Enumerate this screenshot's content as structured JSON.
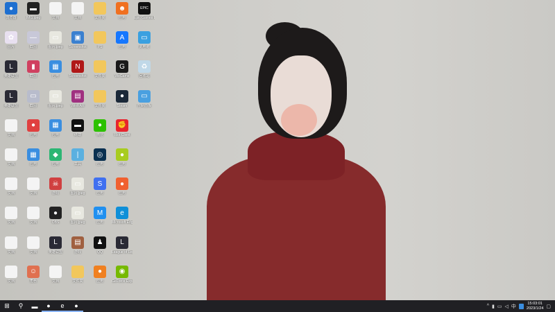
{
  "desktop": {
    "icons": [
      {
        "label": "浏览器",
        "glyph": "●",
        "color": "#1e6fd0"
      },
      {
        "label": "图片",
        "glyph": "✿",
        "color": "#e8e0f0"
      },
      {
        "label": "英雄联盟",
        "glyph": "L",
        "color": "#2a2a35"
      },
      {
        "label": "英雄联盟",
        "glyph": "L",
        "color": "#2a2a35"
      },
      {
        "label": "文档",
        "glyph": "",
        "color": "#f4f4f4"
      },
      {
        "label": "文档",
        "glyph": "",
        "color": "#f4f4f4"
      },
      {
        "label": "文档",
        "glyph": "",
        "color": "#f4f4f4"
      },
      {
        "label": "文档",
        "glyph": "",
        "color": "#f4f4f4"
      },
      {
        "label": "文档",
        "glyph": "",
        "color": "#f4f4f4"
      },
      {
        "label": "文档",
        "glyph": "",
        "color": "#f4f4f4"
      },
      {
        "label": "IMG.jpeg",
        "glyph": "▬",
        "color": "#222"
      },
      {
        "label": "截图",
        "glyph": "—",
        "color": "#c8c8d8"
      },
      {
        "label": "截图",
        "glyph": "▮",
        "color": "#d04060"
      },
      {
        "label": "截图",
        "glyph": "▭",
        "color": "#b8bccc"
      },
      {
        "label": "应用",
        "glyph": "●",
        "color": "#e04040"
      },
      {
        "label": "应用",
        "glyph": "▦",
        "color": "#3a8ee0"
      },
      {
        "label": "文档",
        "glyph": "",
        "color": "#f4f4f4"
      },
      {
        "label": "文档",
        "glyph": "",
        "color": "#f4f4f4"
      },
      {
        "label": "文档",
        "glyph": "",
        "color": "#f4f4f4"
      },
      {
        "label": "角色",
        "glyph": "☺",
        "color": "#e07050"
      },
      {
        "label": "文档",
        "glyph": "",
        "color": "#f4f4f4"
      },
      {
        "label": "图片.jpeg",
        "glyph": "▭",
        "color": "#e8e8e0"
      },
      {
        "label": "应用",
        "glyph": "▦",
        "color": "#3a8ee0"
      },
      {
        "label": "图片.jpeg",
        "glyph": "▭",
        "color": "#e8e8e0"
      },
      {
        "label": "应用",
        "glyph": "▦",
        "color": "#3a8ee0"
      },
      {
        "label": "应用",
        "glyph": "◆",
        "color": "#2bb673"
      },
      {
        "label": "游戏",
        "glyph": "☠",
        "color": "#d04040"
      },
      {
        "label": "OBS",
        "glyph": "●",
        "color": "#222"
      },
      {
        "label": "英雄联盟",
        "glyph": "L",
        "color": "#2a2a35"
      },
      {
        "label": "文档",
        "glyph": "",
        "color": "#f4f4f4"
      },
      {
        "label": "文档",
        "glyph": "",
        "color": "#f4f4f4"
      },
      {
        "label": "Screenshot",
        "glyph": "▣",
        "color": "#3a80d0"
      },
      {
        "label": "Screenshot",
        "glyph": "N",
        "color": "#b01818"
      },
      {
        "label": "WinRAR",
        "glyph": "▤",
        "color": "#a03080"
      },
      {
        "label": "终端",
        "glyph": "▬",
        "color": "#111"
      },
      {
        "label": "工具",
        "glyph": "|",
        "color": "#5ab0e0"
      },
      {
        "label": "图片.jpeg",
        "glyph": "▭",
        "color": "#e8e8e0"
      },
      {
        "label": "图片.jpeg",
        "glyph": "▭",
        "color": "#e8e8e0"
      },
      {
        "label": "游戏",
        "glyph": "▤",
        "color": "#a06040"
      },
      {
        "label": "文件夹",
        "glyph": "",
        "color": "#f2c75c"
      },
      {
        "label": "文件夹",
        "glyph": "",
        "color": "#f2c75c"
      },
      {
        "label": "PS",
        "glyph": "",
        "color": "#f2c75c"
      },
      {
        "label": "文件夹",
        "glyph": "",
        "color": "#f2c75c"
      },
      {
        "label": "文件夹",
        "glyph": "",
        "color": "#f2c75c"
      },
      {
        "label": "微信",
        "glyph": "●",
        "color": "#2dc100"
      },
      {
        "label": "应用",
        "glyph": "◎",
        "color": "#0a3050"
      },
      {
        "label": "应用",
        "glyph": "S",
        "color": "#4070f0"
      },
      {
        "label": "应用",
        "glyph": "M",
        "color": "#2090f0"
      },
      {
        "label": "QQ",
        "glyph": "♟",
        "color": "#111"
      },
      {
        "label": "应用",
        "glyph": "●",
        "color": "#f08020"
      },
      {
        "label": "应用",
        "glyph": "☻",
        "color": "#f07020"
      },
      {
        "label": "应用",
        "glyph": "A",
        "color": "#1677ff"
      },
      {
        "label": "WeGame",
        "glyph": "G",
        "color": "#1a1a1a"
      },
      {
        "label": "Steam",
        "glyph": "●",
        "color": "#1b2838"
      },
      {
        "label": "Riot Client",
        "glyph": "✊",
        "color": "#e8242d"
      },
      {
        "label": "应用",
        "glyph": "●",
        "color": "#a8cc20"
      },
      {
        "label": "应用",
        "glyph": "●",
        "color": "#f06030"
      },
      {
        "label": "Microsoft Edge",
        "glyph": "e",
        "color": "#0f8fd8"
      },
      {
        "label": "League of Legends",
        "glyph": "L",
        "color": "#2a2a35"
      },
      {
        "label": "GeForce Experience",
        "glyph": "◉",
        "color": "#76b900"
      },
      {
        "label": "Epic Games Launcher",
        "glyph": "EPIC",
        "color": "#111"
      },
      {
        "label": "此电脑",
        "glyph": "▭",
        "color": "#3aa0e0"
      },
      {
        "label": "回收站",
        "glyph": "♻",
        "color": "#c0d8e8"
      },
      {
        "label": "控制面板",
        "glyph": "▭",
        "color": "#4aa0e0"
      }
    ],
    "columns": [
      10,
      10,
      10,
      10,
      10,
      10,
      4
    ]
  },
  "taskbar": {
    "items": [
      {
        "name": "start",
        "glyph": "⊞"
      },
      {
        "name": "search",
        "glyph": "⚲"
      },
      {
        "name": "file-explorer",
        "glyph": "▬"
      },
      {
        "name": "steam",
        "glyph": "●"
      },
      {
        "name": "edge",
        "glyph": "e"
      },
      {
        "name": "obs",
        "glyph": "●"
      }
    ],
    "tray": {
      "chevron": "^",
      "mic": "▮",
      "network": "▭",
      "volume": "◁",
      "ime": "中",
      "time": "15:03:01",
      "date": "2023/1/24",
      "notification": "▢"
    }
  }
}
